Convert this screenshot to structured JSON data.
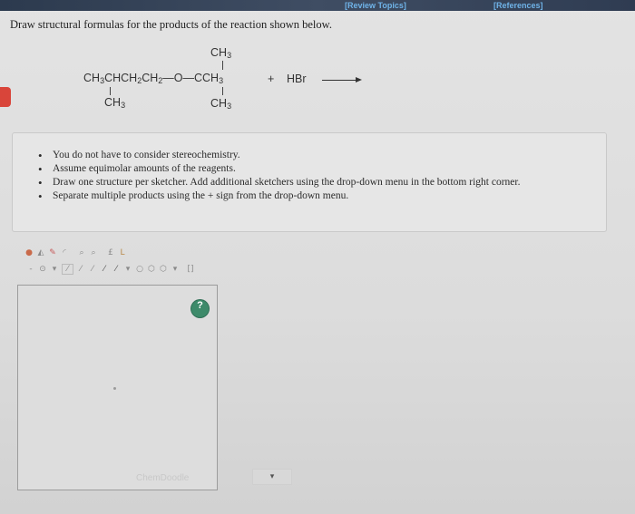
{
  "header": {
    "review_topics": "[Review Topics]",
    "references": "[References]"
  },
  "question": "Draw structural formulas for the products of the reaction shown below.",
  "reaction": {
    "top_ch3": "CH3",
    "main_chain": "CH3CHCH2CH2—O—CCH3",
    "plus": "+",
    "reagent": "HBr",
    "bottom_left_ch3": "CH3",
    "bottom_right_ch3": "CH3"
  },
  "instructions": [
    "You do not have to consider stereochemistry.",
    "Assume equimolar amounts of the reagents.",
    "Draw one structure per sketcher. Add additional sketchers using the drop-down menu in the bottom right corner.",
    "Separate multiple products using the + sign from the drop-down menu."
  ],
  "sketcher": {
    "help_label": "?",
    "toolbar1_icons": [
      "drop-icon",
      "eraser-icon",
      "pencil-icon",
      "lasso-icon",
      "zoom-in-icon",
      "zoom-out-icon",
      "template-icon",
      "chain-icon"
    ],
    "toolbar2_icons": [
      "minus-charge-icon",
      "dot-icon",
      "dropdown-arrow-icon",
      "single-bond-icon",
      "double-bond-icon",
      "triple-bond-icon",
      "wedge-bond-icon",
      "ring-cyclopropane-icon",
      "ring-cyclohexane-icon",
      "ring-benzene-icon",
      "ring-dropdown-icon",
      "bracket-icon"
    ],
    "watermark": "ChemDoodle",
    "dropdown_value": "▾"
  }
}
